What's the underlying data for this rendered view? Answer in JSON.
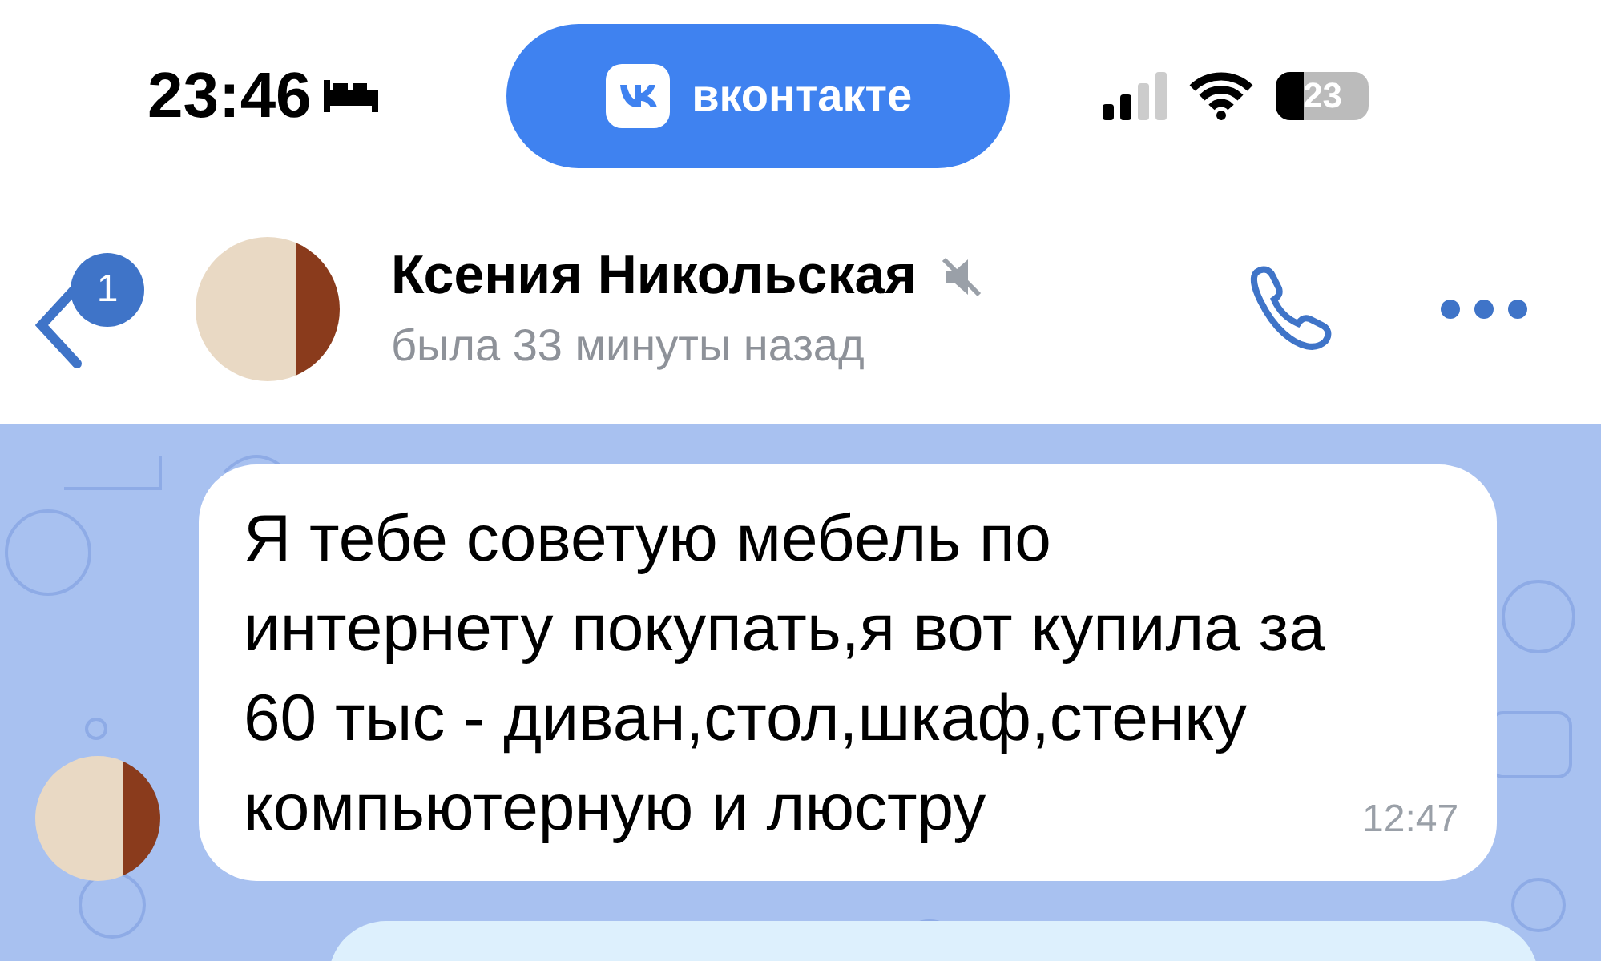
{
  "status_bar": {
    "time": "23:46",
    "app_pill": {
      "label": "вконтакте"
    },
    "battery": "23"
  },
  "header": {
    "unread_badge": "1",
    "name": "Ксения Никольская",
    "muted": true,
    "status": "была 33 минуты назад"
  },
  "messages": [
    {
      "kind": "incoming",
      "text": "Я тебе советую мебель по интернету покупать,я вот купила за 60 тыс - диван,стол,шкаф,стенку компьютерную и люстру",
      "time": "12:47"
    },
    {
      "kind": "outgoing"
    }
  ]
}
